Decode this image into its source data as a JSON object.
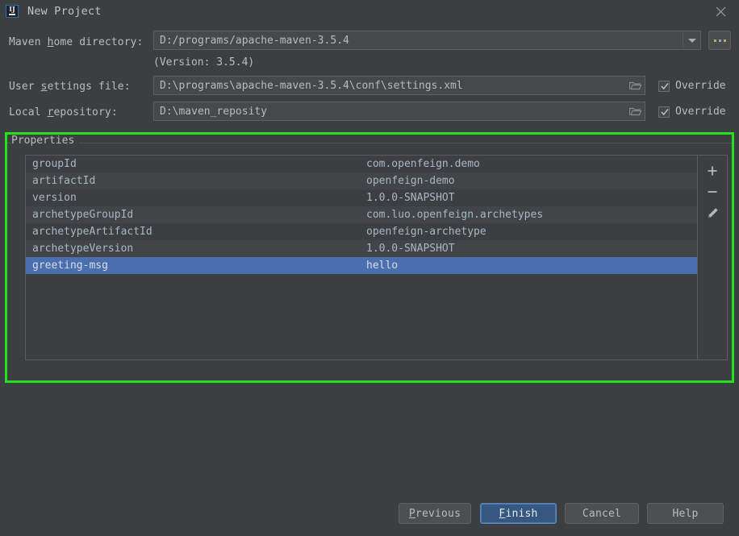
{
  "window": {
    "title": "New Project",
    "app_icon": "intellij-idea-logo",
    "close_icon": "close-icon",
    "background_color": "#3c3f41"
  },
  "highlight": {
    "color": "#21e21b",
    "target": "properties-group"
  },
  "form": {
    "maven_home": {
      "label_prefix": "Maven ",
      "label_mnemonic": "h",
      "label_suffix": "ome directory:",
      "value": "D:/programs/apache-maven-3.5.4",
      "dropdown_icon": "chevron-down-icon",
      "browse_label": "...",
      "version_note": "(Version: 3.5.4)"
    },
    "user_settings": {
      "label_prefix": "User ",
      "label_mnemonic": "s",
      "label_suffix": "ettings file:",
      "value": "D:\\programs\\apache-maven-3.5.4\\conf\\settings.xml",
      "browse_icon": "folder-icon",
      "override_label": "Override",
      "override_checked": true
    },
    "local_repository": {
      "label_prefix": "Local ",
      "label_mnemonic": "r",
      "label_suffix": "epository:",
      "value": "D:\\maven_reposity",
      "browse_icon": "folder-icon",
      "override_label": "Override",
      "override_checked": true
    }
  },
  "properties": {
    "group_title": "Properties",
    "rows": [
      {
        "key": "groupId",
        "value": "com.openfeign.demo"
      },
      {
        "key": "artifactId",
        "value": "openfeign-demo"
      },
      {
        "key": "version",
        "value": "1.0.0-SNAPSHOT"
      },
      {
        "key": "archetypeGroupId",
        "value": "com.luo.openfeign.archetypes"
      },
      {
        "key": "archetypeArtifactId",
        "value": "openfeign-archetype"
      },
      {
        "key": "archetypeVersion",
        "value": "1.0.0-SNAPSHOT"
      },
      {
        "key": "greeting-msg",
        "value": "hello",
        "selected": true
      }
    ],
    "selected_row_color": "#4b6eaf",
    "toolbar": [
      {
        "name": "add-property-button",
        "icon": "plus-icon"
      },
      {
        "name": "remove-property-button",
        "icon": "minus-icon"
      },
      {
        "name": "edit-property-button",
        "icon": "pencil-icon"
      }
    ]
  },
  "buttons": {
    "previous": {
      "label_prefix": "",
      "label_mnemonic": "P",
      "label_suffix": "revious"
    },
    "finish": {
      "label_prefix": "",
      "label_mnemonic": "F",
      "label_suffix": "inish",
      "default": true
    },
    "cancel": {
      "label": "Cancel"
    },
    "help": {
      "label": "Help"
    }
  }
}
